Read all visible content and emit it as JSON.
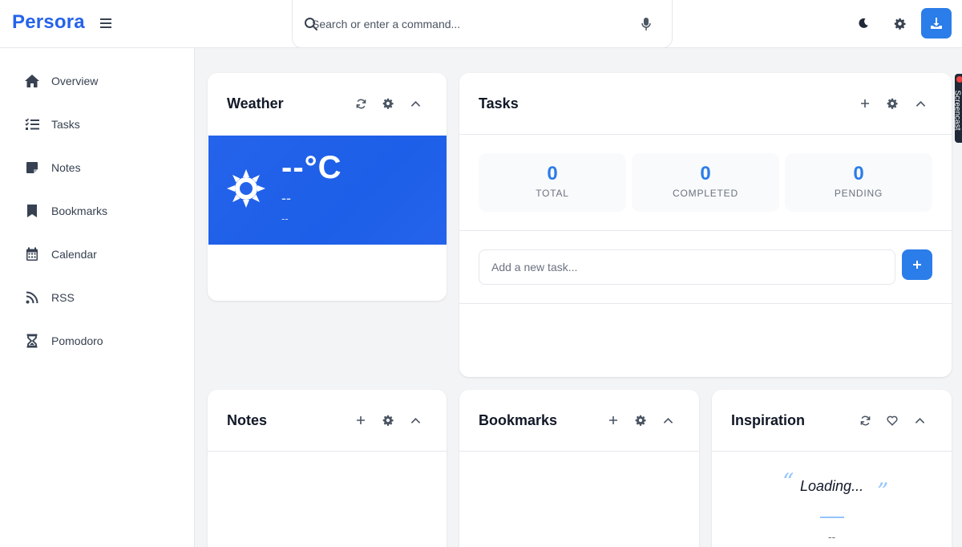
{
  "app": {
    "brand": "Persora"
  },
  "header": {
    "search_placeholder": "Search or enter a command...",
    "icons": [
      "menu-icon",
      "search-icon",
      "microphone-icon",
      "moon-icon",
      "gear-icon",
      "download-icon"
    ]
  },
  "sidebar": {
    "items": [
      {
        "label": "Overview",
        "icon": "home-icon"
      },
      {
        "label": "Tasks",
        "icon": "task-list-icon"
      },
      {
        "label": "Notes",
        "icon": "note-icon"
      },
      {
        "label": "Bookmarks",
        "icon": "bookmark-icon"
      },
      {
        "label": "Calendar",
        "icon": "calendar-icon"
      },
      {
        "label": "RSS",
        "icon": "rss-icon"
      },
      {
        "label": "Pomodoro",
        "icon": "hourglass-icon"
      }
    ]
  },
  "widgets": {
    "weather": {
      "title": "Weather",
      "temp": "--°C",
      "description": "--",
      "location": "--"
    },
    "tasks": {
      "title": "Tasks",
      "stats": [
        {
          "value": "0",
          "label": "TOTAL"
        },
        {
          "value": "0",
          "label": "COMPLETED"
        },
        {
          "value": "0",
          "label": "PENDING"
        }
      ],
      "input_placeholder": "Add a new task..."
    },
    "notes": {
      "title": "Notes"
    },
    "bookmarks": {
      "title": "Bookmarks"
    },
    "inspiration": {
      "title": "Inspiration",
      "quote": "Loading...",
      "author": "--"
    }
  },
  "screencast_tab": {
    "label": "Screencast"
  },
  "colors": {
    "accent": "#2b7de9",
    "brand": "#2563eb",
    "weather_bg": "#2563eb"
  }
}
